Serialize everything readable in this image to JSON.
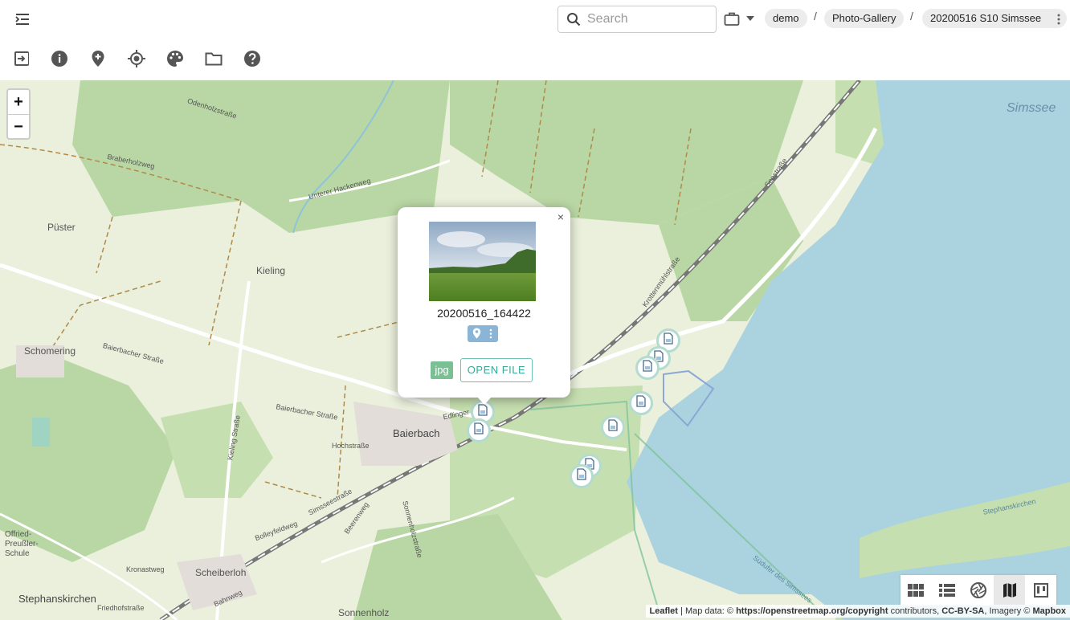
{
  "header": {
    "search_placeholder": "Search",
    "breadcrumbs": [
      "demo",
      "Photo-Gallery",
      "20200516 S10 Simssee"
    ],
    "separator": "/"
  },
  "toolbar": {
    "icons": [
      "exit-icon",
      "info-icon",
      "add-location-icon",
      "locate-icon",
      "palette-icon",
      "folder-icon",
      "help-icon"
    ]
  },
  "map": {
    "zoom_in": "+",
    "zoom_out": "−",
    "labels": {
      "lake": "Simssee",
      "puster": "Püster",
      "kieling": "Kieling",
      "schomering": "Schomering",
      "baierbach": "Baierbach",
      "scheiberloh": "Scheiberloh",
      "stephanskirchen": "Stephanskirchen",
      "sonnenholz": "Sonnenholz",
      "school": "Offried-Preußler-Schule",
      "road1": "Baierbacher Straße",
      "road2": "Unterer Hackenweg",
      "road3": "Simsseestraße",
      "road4": "Kieling Straße",
      "road5": "Hochstraße",
      "road6": "Kronastweg",
      "road7": "Bolleyfeldweg",
      "road8": "Seestraße",
      "road9": "Krottenmühlstraße",
      "road10": "Edlinger Straße",
      "road11": "Südufer des Simssees",
      "road12": "Stephanskirchen",
      "road13": "Odenholzstraße",
      "road14": "Braberholzweg",
      "road15": "Friedhofstraße",
      "road16": "Bahnweg",
      "road17": "Beerenweg",
      "road18": "Sonnenholzstraße"
    },
    "attribution": {
      "leaflet": "Leaflet",
      "sep": " | Map data: © ",
      "osm": "https://openstreetmap.org/copyright",
      "contrib": " contributors, ",
      "license": "CC-BY-SA",
      "imagery": ", Imagery © ",
      "mapbox": "Mapbox"
    }
  },
  "popup": {
    "close": "×",
    "title": "20200516_164422",
    "type_badge": "jpg",
    "open_button": "OPEN FILE"
  },
  "viewbar": {
    "views": [
      "grid-view-icon",
      "list-view-icon",
      "aperture-icon",
      "map-icon",
      "board-icon"
    ],
    "active": "map-icon"
  },
  "colors": {
    "forest": "#b9d7a4",
    "meadow": "#d6e8bc",
    "lake": "#aad3df",
    "accent": "#3aa897",
    "chip": "#8ab5d6"
  }
}
